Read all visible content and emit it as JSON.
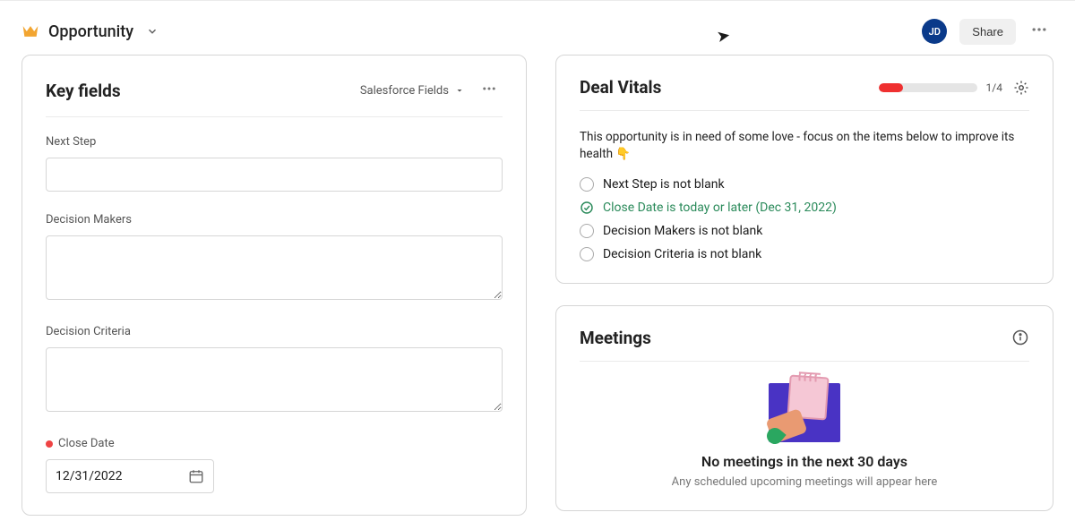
{
  "header": {
    "title": "Opportunity",
    "avatar_initials": "JD",
    "share_label": "Share"
  },
  "key_fields": {
    "title": "Key fields",
    "dropdown_label": "Salesforce Fields",
    "fields": {
      "next_step_label": "Next Step",
      "next_step_value": "",
      "decision_makers_label": "Decision Makers",
      "decision_makers_value": "",
      "decision_criteria_label": "Decision Criteria",
      "decision_criteria_value": "",
      "close_date_label": "Close Date",
      "close_date_value": "12/31/2022"
    }
  },
  "deal_vitals": {
    "title": "Deal Vitals",
    "progress": {
      "completed": 1,
      "total": 4,
      "label": "1/4",
      "fill_color": "#ef3030"
    },
    "description": "This opportunity is in need of some love - focus on the items below to improve its health 👇",
    "items": [
      {
        "text": "Next Step is not blank",
        "done": false
      },
      {
        "text": "Close Date is today or later (Dec 31, 2022)",
        "done": true
      },
      {
        "text": "Decision Makers is not blank",
        "done": false
      },
      {
        "text": "Decision Criteria is not blank",
        "done": false
      }
    ]
  },
  "meetings": {
    "title": "Meetings",
    "empty_title": "No meetings in the next 30 days",
    "empty_sub": "Any scheduled upcoming meetings will appear here"
  }
}
